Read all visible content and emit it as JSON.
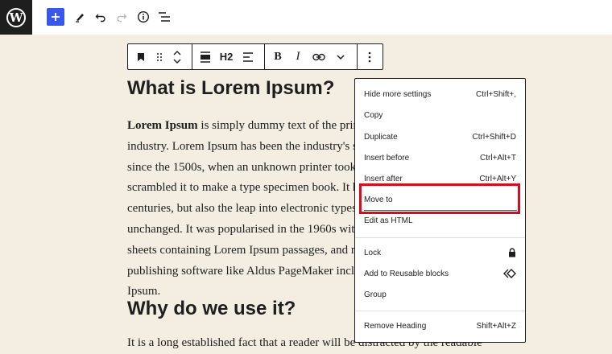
{
  "toolbar_top": {
    "logo_letter": "W",
    "add_icon": "plus-icon",
    "icons": [
      "plus-icon",
      "pen-icon",
      "undo-icon",
      "redo-icon",
      "info-icon",
      "list-view-icon"
    ]
  },
  "block_toolbar": {
    "heading_level": "H2",
    "bold": "B",
    "italic": "I"
  },
  "content": {
    "heading1": "What is Lorem Ipsum?",
    "para_bold": "Lorem Ipsum",
    "para_lines": [
      " is simply dummy text of the prin",
      "industry. Lorem Ipsum has been the industry's s",
      "since the 1500s, when an unknown printer took",
      "scrambled it to make a type specimen book. It h",
      "centuries, but also the leap into electronic typese",
      "unchanged. It was popularised in the 1960s with",
      "sheets containing Lorem Ipsum passages, and m",
      "publishing software like Aldus PageMaker inclu",
      "Ipsum."
    ],
    "heading2": "Why do we use it?",
    "para2": "It is a long established fact that a reader will be distracted by the readable"
  },
  "menu": {
    "items": [
      {
        "label": "Hide more settings",
        "shortcut": "Ctrl+Shift+,"
      },
      {
        "label": "Copy",
        "shortcut": ""
      },
      {
        "label": "Duplicate",
        "shortcut": "Ctrl+Shift+D"
      },
      {
        "label": "Insert before",
        "shortcut": "Ctrl+Alt+T"
      },
      {
        "label": "Insert after",
        "shortcut": "Ctrl+Alt+Y"
      },
      {
        "label": "Move to",
        "shortcut": ""
      },
      {
        "label": "Edit as HTML",
        "shortcut": ""
      },
      {
        "label": "Lock",
        "shortcut": "lock-icon"
      },
      {
        "label": "Add to Reusable blocks",
        "shortcut": "reusable-block-icon"
      },
      {
        "label": "Group",
        "shortcut": ""
      },
      {
        "label": "Remove Heading",
        "shortcut": "Shift+Alt+Z"
      }
    ],
    "accent": "#3858e9",
    "highlight_color": "#d40e1c"
  }
}
